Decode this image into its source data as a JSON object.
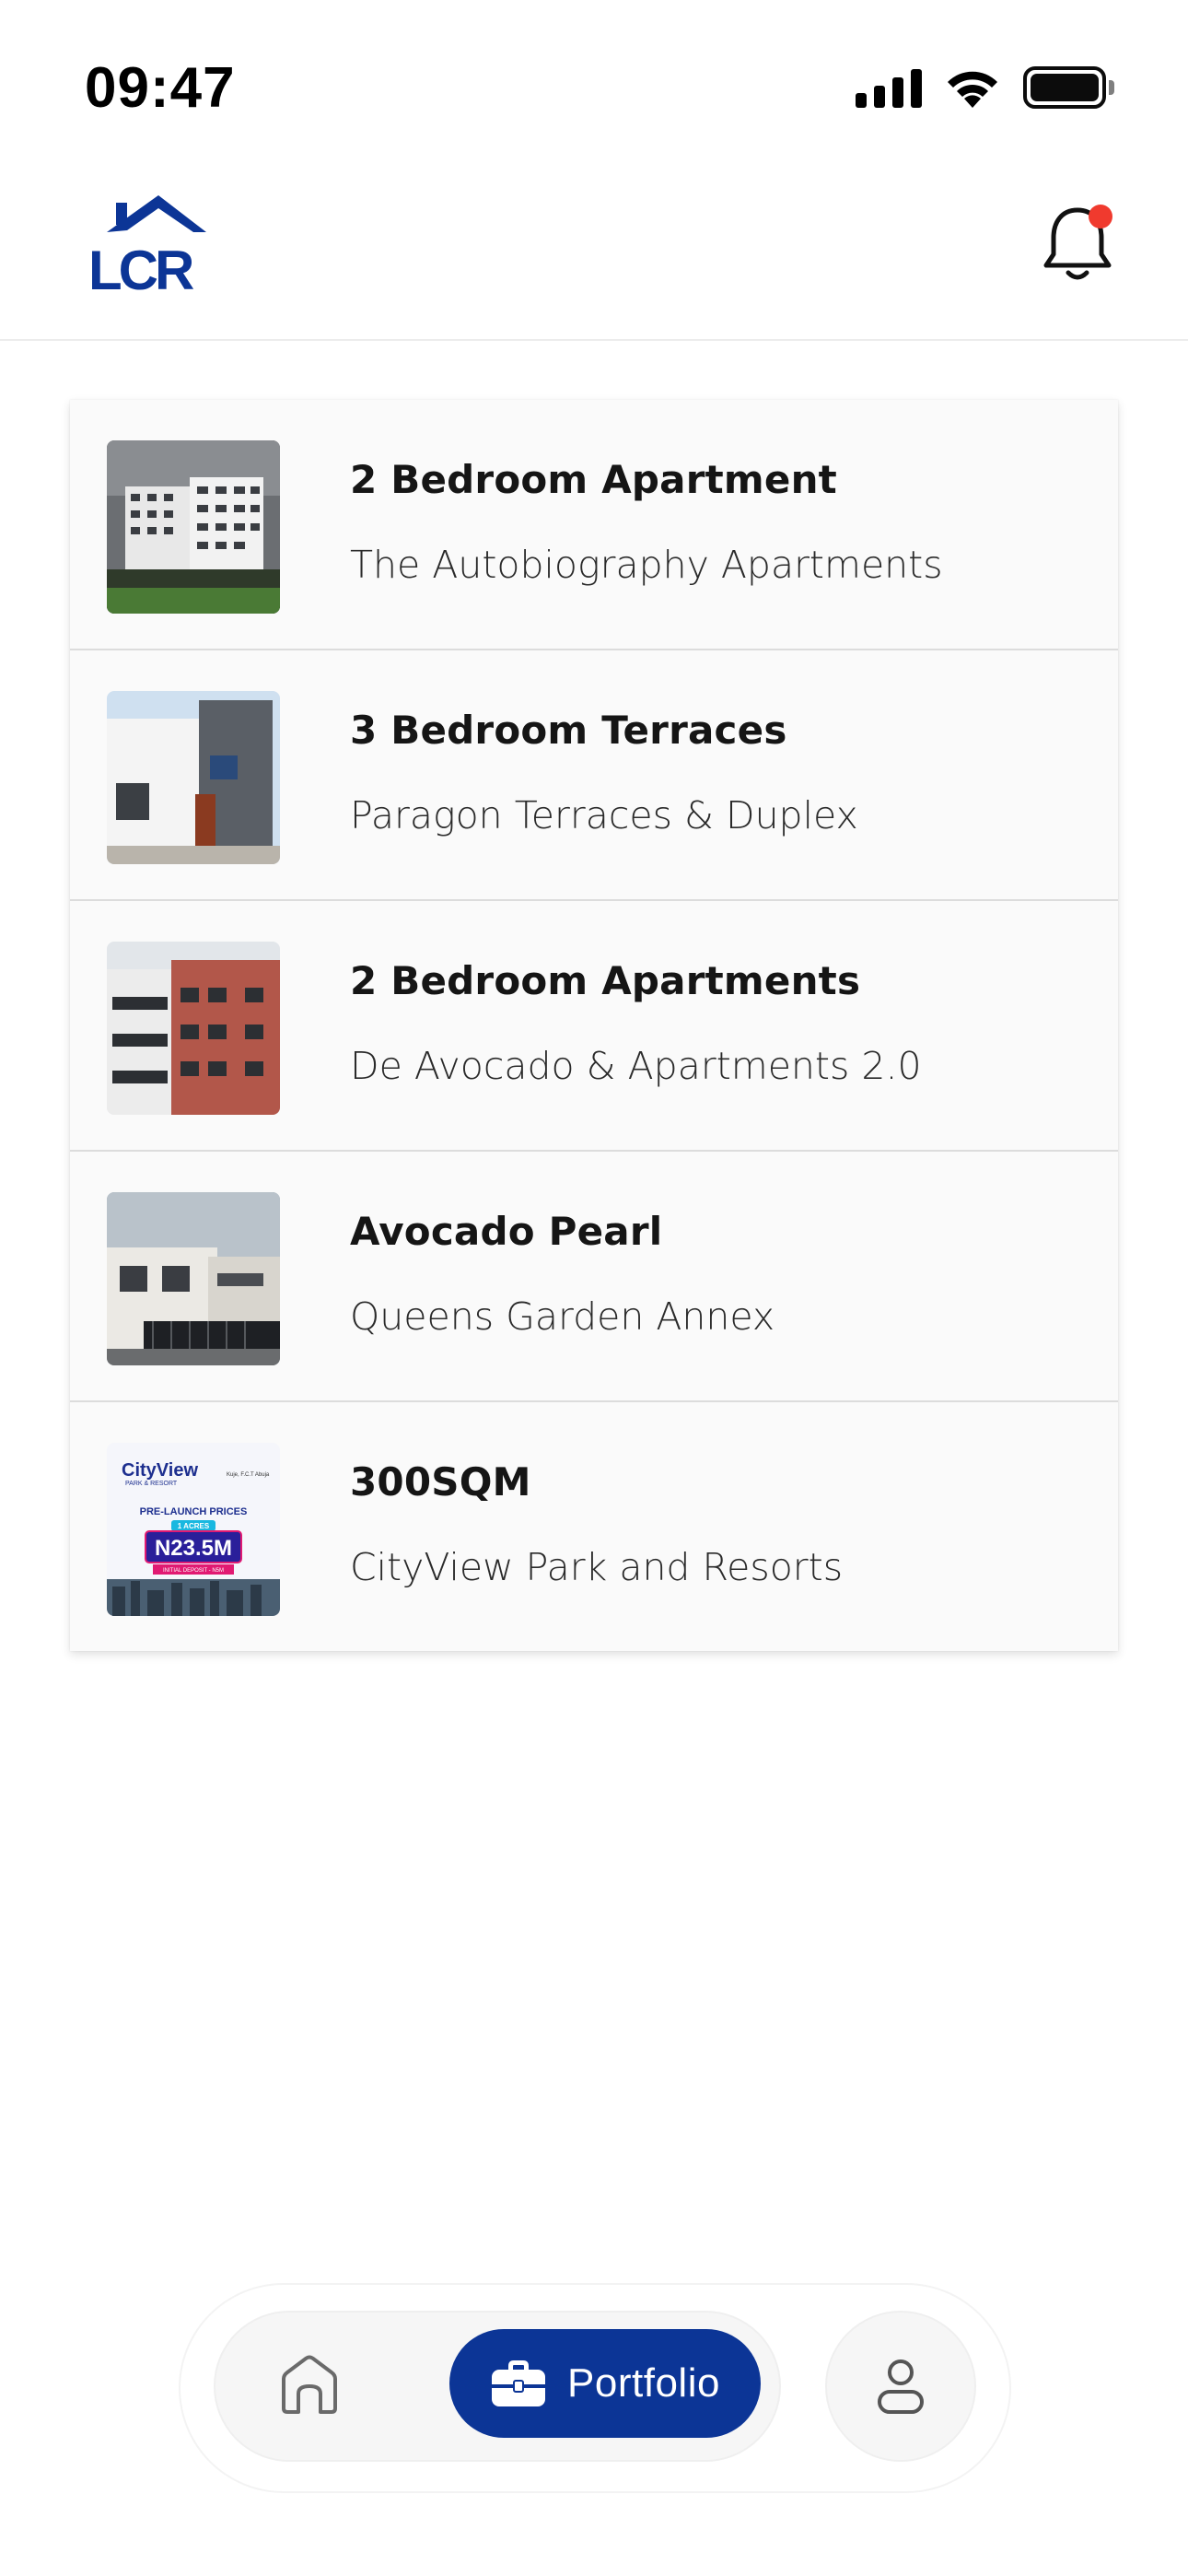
{
  "status_bar": {
    "time": "09:47",
    "icons": [
      "signal-icon",
      "wifi-icon",
      "battery-icon"
    ]
  },
  "header": {
    "logo_text": "LCR",
    "brand_color": "#0c3596",
    "notification_dot_color": "#f03a2e"
  },
  "listings": [
    {
      "title": "2 Bedroom Apartment",
      "subtitle": "The Autobiography Apartments"
    },
    {
      "title": "3 Bedroom Terraces",
      "subtitle": "Paragon Terraces & Duplex"
    },
    {
      "title": "2 Bedroom Apartments",
      "subtitle": "De Avocado & Apartments 2.0"
    },
    {
      "title": "Avocado Pearl",
      "subtitle": "Queens Garden Annex"
    },
    {
      "title": "300SQM",
      "subtitle": "CityView Park and Resorts",
      "thumbnail_text": {
        "brand": "CityView",
        "tagline": "PARK & RESORT",
        "headline": "PRE-LAUNCH PRICES",
        "badge": "1 ACRES",
        "price": "N23.5M",
        "deposit": "INITIAL DEPOSIT - N5M",
        "location": "Kuje, F.C.T Abuja"
      }
    }
  ],
  "bottom_nav": {
    "items": [
      {
        "icon": "home-icon"
      },
      {
        "icon": "briefcase-icon",
        "label": "Portfolio",
        "active": true
      },
      {
        "icon": "profile-icon"
      }
    ]
  }
}
